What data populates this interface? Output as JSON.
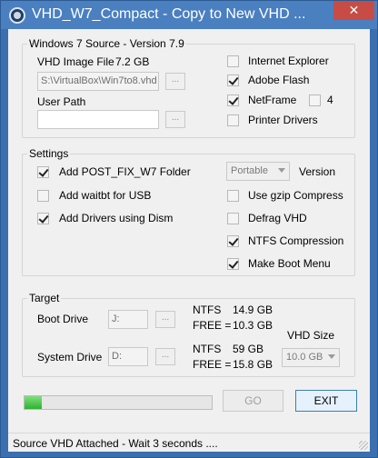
{
  "window": {
    "title": "VHD_W7_Compact - Copy to New VHD ...",
    "close_label": "✕"
  },
  "source": {
    "group_title": "Windows 7 Source - Version 7.9",
    "vhd_label": "VHD Image File",
    "vhd_size": "7.2 GB",
    "vhd_path": "S:\\VirtualBox\\Win7to8.vhd",
    "browse_label": "...",
    "user_path_label": "User Path",
    "user_path_value": "",
    "options": [
      {
        "label": "Internet Explorer",
        "checked": false
      },
      {
        "label": "Adobe Flash",
        "checked": true
      },
      {
        "label": "NetFrame",
        "checked": true
      },
      {
        "label": "Printer Drivers",
        "checked": false
      }
    ],
    "netframe_extra_label": "4",
    "netframe_extra_checked": false
  },
  "settings": {
    "group_title": "Settings",
    "left": [
      {
        "label": "Add POST_FIX_W7  Folder",
        "checked": true
      },
      {
        "label": "Add waitbt for USB",
        "checked": false
      },
      {
        "label": "Add Drivers using Dism",
        "checked": true
      }
    ],
    "right": [
      {
        "label": "Use gzip Compress",
        "checked": false
      },
      {
        "label": "Defrag VHD",
        "checked": false
      },
      {
        "label": "NTFS Compression",
        "checked": true
      },
      {
        "label": "Make Boot Menu",
        "checked": true
      }
    ],
    "version_value": "Portable",
    "version_label": "Version"
  },
  "target": {
    "group_title": "Target",
    "boot_label": "Boot Drive",
    "boot_value": "J:",
    "boot_fs": "NTFS",
    "boot_total": "14.9 GB",
    "boot_free_label": "FREE  =",
    "boot_free": "10.3 GB",
    "system_label": "System Drive",
    "system_value": "D:",
    "system_fs": "NTFS",
    "system_total": "59 GB",
    "system_free_label": "FREE  =",
    "system_free": "15.8 GB",
    "vhd_size_label": "VHD Size",
    "vhd_size_value": "10.0 GB"
  },
  "progress": {
    "percent": 9,
    "color": "#2fb12f"
  },
  "buttons": {
    "go": "GO",
    "exit": "EXIT"
  },
  "status": {
    "text": "Source VHD Attached - Wait 3 seconds ...."
  }
}
